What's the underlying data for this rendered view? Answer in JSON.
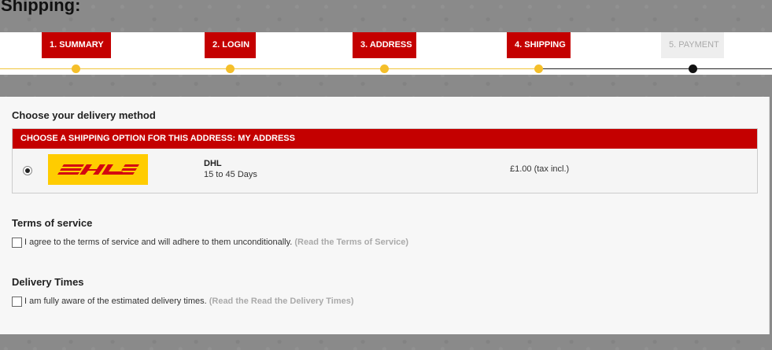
{
  "page": {
    "title": "Shipping:"
  },
  "steps": [
    {
      "label": "1. SUMMARY",
      "state": "done"
    },
    {
      "label": "2. LOGIN",
      "state": "done"
    },
    {
      "label": "3. ADDRESS",
      "state": "done"
    },
    {
      "label": "4. SHIPPING",
      "state": "current"
    },
    {
      "label": "5. PAYMENT",
      "state": "pending"
    }
  ],
  "delivery": {
    "heading": "Choose your delivery method",
    "box_header": "CHOOSE A SHIPPING OPTION FOR THIS ADDRESS: MY ADDRESS",
    "carrier": {
      "logo_icon": "dhl-logo",
      "name": "DHL",
      "delay": "15 to 45 Days",
      "price": "£1.00 (tax incl.)",
      "selected": true
    }
  },
  "terms": {
    "heading": "Terms of service",
    "text": "I agree to the terms of service and will adhere to them unconditionally.",
    "link": "(Read the Terms of Service)",
    "checked": false
  },
  "delivery_times": {
    "heading": "Delivery Times",
    "text": "I am fully aware of the estimated delivery times.",
    "link": "(Read the Read the Delivery Times)",
    "checked": false
  },
  "colors": {
    "accent": "#c40000",
    "progress_done": "#f5bf2a",
    "progress_pending": "#111111",
    "dhl_yellow": "#ffcc00",
    "dhl_red": "#d40511"
  }
}
